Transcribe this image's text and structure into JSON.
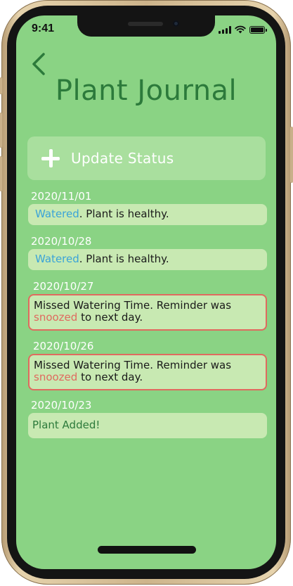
{
  "status_bar": {
    "time": "9:41",
    "icons": [
      "cellular-signal-icon",
      "wifi-icon",
      "battery-icon"
    ]
  },
  "header": {
    "back_icon": "chevron-left-icon",
    "title": "Plant Journal"
  },
  "update_button": {
    "icon": "plus-icon",
    "label": "Update Status"
  },
  "entries": [
    {
      "date": "2020/11/01",
      "highlight": "Watered",
      "text": ". Plant is healthy."
    },
    {
      "date": "2020/10/28",
      "highlight": "Watered",
      "text": ". Plant is healthy."
    },
    {
      "date": "2020/10/27",
      "prefix": "Missed Watering Time. Reminder was",
      "highlight": "snoozed",
      "suffix": " to next day."
    },
    {
      "date": "2020/10/26",
      "prefix": "Missed Watering Time. Reminder was",
      "highlight": "snoozed",
      "suffix": " to next day."
    },
    {
      "date": "2020/10/23",
      "text": "Plant Added!"
    }
  ],
  "colors": {
    "screen_bg": "#8ad384",
    "title": "#2c7a3b",
    "card_bg": "#c8e9b2",
    "watered_highlight": "#3aa3d8",
    "snoozed_highlight": "#e06a5f"
  }
}
